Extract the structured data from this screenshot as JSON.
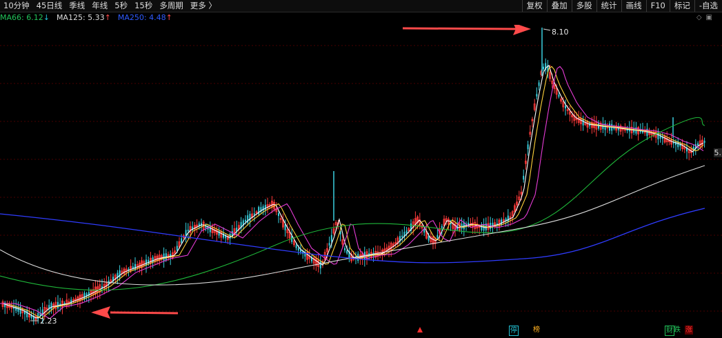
{
  "toolbar": {
    "periods": [
      "10分钟",
      "45日线",
      "季线",
      "年线",
      "5秒",
      "15秒",
      "多周期",
      "更多 〉"
    ],
    "tools": [
      "复权",
      "叠加",
      "多股",
      "统计",
      "画线",
      "F10",
      "标记",
      "-自选"
    ]
  },
  "ma": [
    {
      "label": "MA66: 6.12",
      "arrow": "↓",
      "color": "#22c35a"
    },
    {
      "label": "MA125: 5.33",
      "arrow": "↑",
      "color": "#dddddd"
    },
    {
      "label": "MA250: 4.48",
      "arrow": "↑",
      "color": "#2f5bff"
    }
  ],
  "corner_icons": [
    "diamond-icon",
    "window-icon"
  ],
  "annotations": {
    "high_price": "8.10",
    "low_price": "2.23",
    "edge_price": "5."
  },
  "badges": [
    {
      "text": "停",
      "color": "#22c3d6"
    },
    {
      "text": "榜",
      "color": "#ffb020"
    },
    {
      "text": "财",
      "color": "#22c35a"
    },
    {
      "text": "跌",
      "color": "#22c35a"
    },
    {
      "text": "涨",
      "color": "#ff3030"
    }
  ],
  "colors": {
    "up": "#ff3b3b",
    "down": "#3ad1e0",
    "arrow": "#ff4a4a",
    "grid": "#5a0000"
  },
  "chart_data": {
    "type": "candlestick",
    "high": 8.1,
    "low": 2.23,
    "series": [
      {
        "name": "MA66",
        "value": 6.12
      },
      {
        "name": "MA125",
        "value": 5.33
      },
      {
        "name": "MA250",
        "value": 4.48
      }
    ]
  }
}
